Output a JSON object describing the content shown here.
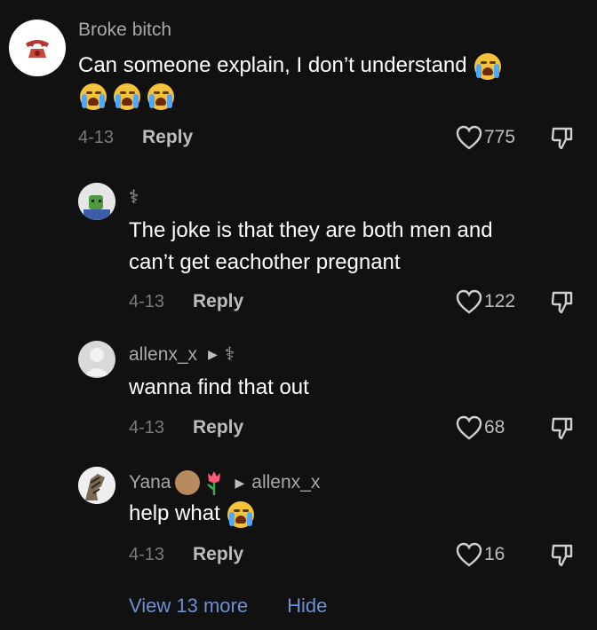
{
  "comments": [
    {
      "username": "Broke bitch",
      "text": "Can someone explain, I don’t understand",
      "date": "4-13",
      "reply_label": "Reply",
      "likes": "775"
    },
    {
      "username_glyph": "⚕",
      "text_line1": "The joke is that they are both men and",
      "text_line2": "can’t get eachother pregnant",
      "date": "4-13",
      "reply_label": "Reply",
      "likes": "122"
    },
    {
      "username": "allenx_x",
      "reply_to_glyph": "⚕",
      "text": "wanna find that out",
      "date": "4-13",
      "reply_label": "Reply",
      "likes": "68"
    },
    {
      "username": "Yana",
      "reply_to": "allenx_x",
      "text": "help what",
      "date": "4-13",
      "reply_label": "Reply",
      "likes": "16"
    }
  ],
  "footer": {
    "view_more": "View 13 more",
    "hide": "Hide"
  },
  "icons": [
    "phone-icon",
    "heart-icon",
    "dislike-icon",
    "loudly-crying-emoji",
    "play-arrow-icon",
    "see-no-evil-monkey-emoji",
    "tulip-emoji"
  ]
}
